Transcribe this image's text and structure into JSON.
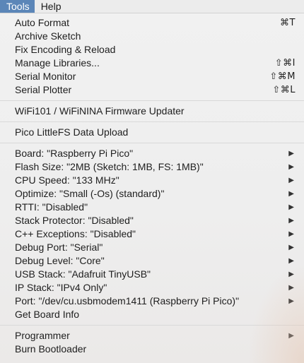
{
  "menubar": {
    "tools": "Tools",
    "help": "Help"
  },
  "menu": {
    "group1": [
      {
        "label": "Auto Format",
        "shortcut": "⌘T"
      },
      {
        "label": "Archive Sketch",
        "shortcut": ""
      },
      {
        "label": "Fix Encoding & Reload",
        "shortcut": ""
      },
      {
        "label": "Manage Libraries...",
        "shortcut": "⇧⌘I"
      },
      {
        "label": "Serial Monitor",
        "shortcut": "⇧⌘M"
      },
      {
        "label": "Serial Plotter",
        "shortcut": "⇧⌘L"
      }
    ],
    "wifi_updater": "WiFi101 / WiFiNINA Firmware Updater",
    "pico_fs_upload": "Pico LittleFS Data Upload",
    "board_options": [
      {
        "label": "Board: \"Raspberry Pi Pico\""
      },
      {
        "label": "Flash Size: \"2MB (Sketch: 1MB, FS: 1MB)\""
      },
      {
        "label": "CPU Speed: \"133 MHz\""
      },
      {
        "label": "Optimize: \"Small (-Os) (standard)\""
      },
      {
        "label": "RTTI: \"Disabled\""
      },
      {
        "label": "Stack Protector: \"Disabled\""
      },
      {
        "label": "C++ Exceptions: \"Disabled\""
      },
      {
        "label": "Debug Port: \"Serial\""
      },
      {
        "label": "Debug Level: \"Core\""
      },
      {
        "label": "USB Stack: \"Adafruit TinyUSB\""
      },
      {
        "label": "IP Stack: \"IPv4 Only\""
      },
      {
        "label": "Port: \"/dev/cu.usbmodem1411 (Raspberry Pi Pico)\""
      }
    ],
    "get_board_info": "Get Board Info",
    "programmer": "Programmer",
    "burn_bootloader": "Burn Bootloader",
    "submenu_arrow": "▶"
  }
}
